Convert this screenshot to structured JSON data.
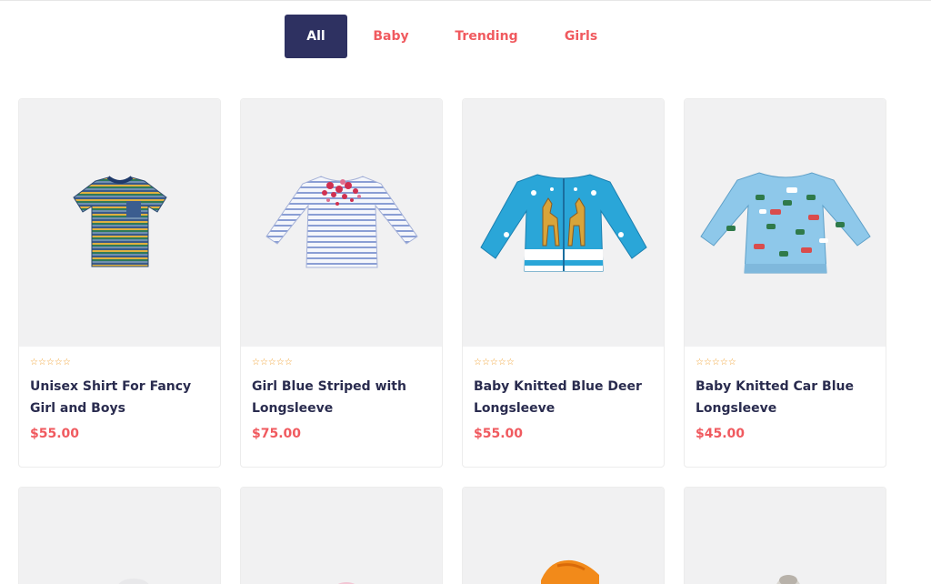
{
  "filters": {
    "tabs": [
      {
        "label": "All",
        "active": true
      },
      {
        "label": "Baby",
        "active": false
      },
      {
        "label": "Trending",
        "active": false
      },
      {
        "label": "Girls",
        "active": false
      }
    ]
  },
  "products": [
    {
      "name": "Unisex Shirt For Fancy Girl and Boys",
      "price": "$55.00",
      "rating": 0,
      "image": "striped-tshirt-icon"
    },
    {
      "name": "Girl Blue Striped with Longsleeve",
      "price": "$75.00",
      "rating": 0,
      "image": "striped-longsleeve-icon"
    },
    {
      "name": "Baby Knitted Blue Deer Longsleeve",
      "price": "$55.00",
      "rating": 0,
      "image": "deer-sweater-icon"
    },
    {
      "name": "Baby Knitted Car Blue Longsleeve",
      "price": "$45.00",
      "rating": 0,
      "image": "car-sweater-icon"
    }
  ],
  "stars_glyph": "☆☆☆☆☆",
  "colors": {
    "accent": "#f05a5f",
    "active_tab": "#2e3161",
    "title": "#2a2c4f",
    "stars": "#f0a030"
  }
}
